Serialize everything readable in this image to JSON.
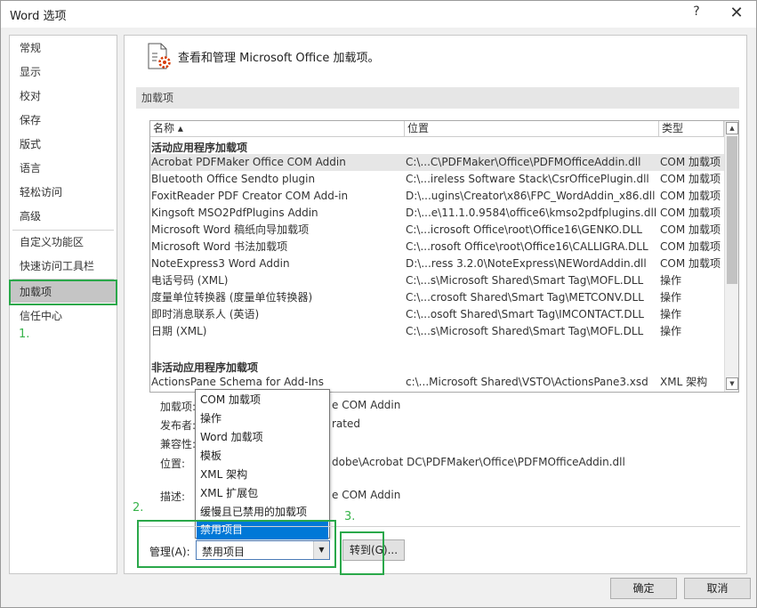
{
  "window": {
    "title": "Word 选项",
    "help_label": "?",
    "close_label": "✕"
  },
  "nav": {
    "items": [
      {
        "label": "常规"
      },
      {
        "label": "显示"
      },
      {
        "label": "校对"
      },
      {
        "label": "保存"
      },
      {
        "label": "版式"
      },
      {
        "label": "语言"
      },
      {
        "label": "轻松访问"
      },
      {
        "label": "高级"
      },
      {
        "label": "自定义功能区"
      },
      {
        "label": "快速访问工具栏"
      },
      {
        "label": "加载项"
      },
      {
        "label": "信任中心"
      }
    ],
    "selected": "加载项"
  },
  "annotations": {
    "step1": "1.",
    "step2": "2.",
    "step3": "3.",
    "highlight_color": "#2aa84a"
  },
  "header": {
    "title": "查看和管理 Microsoft Office 加载项。",
    "icon": "addins-gear-icon"
  },
  "section": {
    "title": "加载项"
  },
  "table": {
    "columns": [
      "名称 ▴",
      "位置",
      "类型"
    ],
    "active_group": "活动应用程序加载项",
    "active_rows": [
      {
        "name": "Acrobat PDFMaker Office COM Addin",
        "location": "C:\\...C\\PDFMaker\\Office\\PDFMOfficeAddin.dll",
        "type": "COM 加载项"
      },
      {
        "name": "Bluetooth Office Sendto plugin",
        "location": "C:\\...ireless Software Stack\\CsrOfficePlugin.dll",
        "type": "COM 加载项"
      },
      {
        "name": "FoxitReader PDF Creator COM Add-in",
        "location": "D:\\...ugins\\Creator\\x86\\FPC_WordAddin_x86.dll",
        "type": "COM 加载项"
      },
      {
        "name": "Kingsoft MSO2PdfPlugins Addin",
        "location": "D:\\...e\\11.1.0.9584\\office6\\kmso2pdfplugins.dll",
        "type": "COM 加载项"
      },
      {
        "name": "Microsoft Word 稿纸向导加载项",
        "location": "C:\\...icrosoft Office\\root\\Office16\\GENKO.DLL",
        "type": "COM 加载项"
      },
      {
        "name": "Microsoft Word 书法加载项",
        "location": "C:\\...rosoft Office\\root\\Office16\\CALLIGRA.DLL",
        "type": "COM 加载项"
      },
      {
        "name": "NoteExpress3 Word Addin",
        "location": "D:\\...ress 3.2.0\\NoteExpress\\NEWordAddin.dll",
        "type": "COM 加载项"
      },
      {
        "name": "电话号码 (XML)",
        "location": "C:\\...s\\Microsoft Shared\\Smart Tag\\MOFL.DLL",
        "type": "操作"
      },
      {
        "name": "度量单位转换器 (度量单位转换器)",
        "location": "C:\\...crosoft Shared\\Smart Tag\\METCONV.DLL",
        "type": "操作"
      },
      {
        "name": "即时消息联系人 (英语)",
        "location": "C:\\...osoft Shared\\Smart Tag\\IMCONTACT.DLL",
        "type": "操作"
      },
      {
        "name": "日期 (XML)",
        "location": "C:\\...s\\Microsoft Shared\\Smart Tag\\MOFL.DLL",
        "type": "操作"
      }
    ],
    "inactive_group": "非活动应用程序加载项",
    "inactive_rows": [
      {
        "name": "ActionsPane Schema for Add-Ins",
        "location": "c:\\...Microsoft Shared\\VSTO\\ActionsPane3.xsd",
        "type": "XML 架构"
      }
    ]
  },
  "details": {
    "addin_label": "加载项:",
    "addin_value": "e COM Addin",
    "publisher_label": "发布者:",
    "publisher_value": "rated",
    "compat_label": "兼容性:",
    "location_label": "位置:",
    "location_value": "dobe\\Acrobat DC\\PDFMaker\\Office\\PDFMOfficeAddin.dll",
    "description_label": "描述:",
    "description_value": "e COM Addin"
  },
  "manage": {
    "label": "管理(A):",
    "selected": "禁用项目",
    "options": [
      "COM 加载项",
      "操作",
      "Word 加载项",
      "模板",
      "XML 架构",
      "XML 扩展包",
      "缓慢且已禁用的加载项",
      "禁用项目"
    ],
    "go_button": "转到(G)..."
  },
  "footer": {
    "ok": "确定",
    "cancel": "取消"
  }
}
